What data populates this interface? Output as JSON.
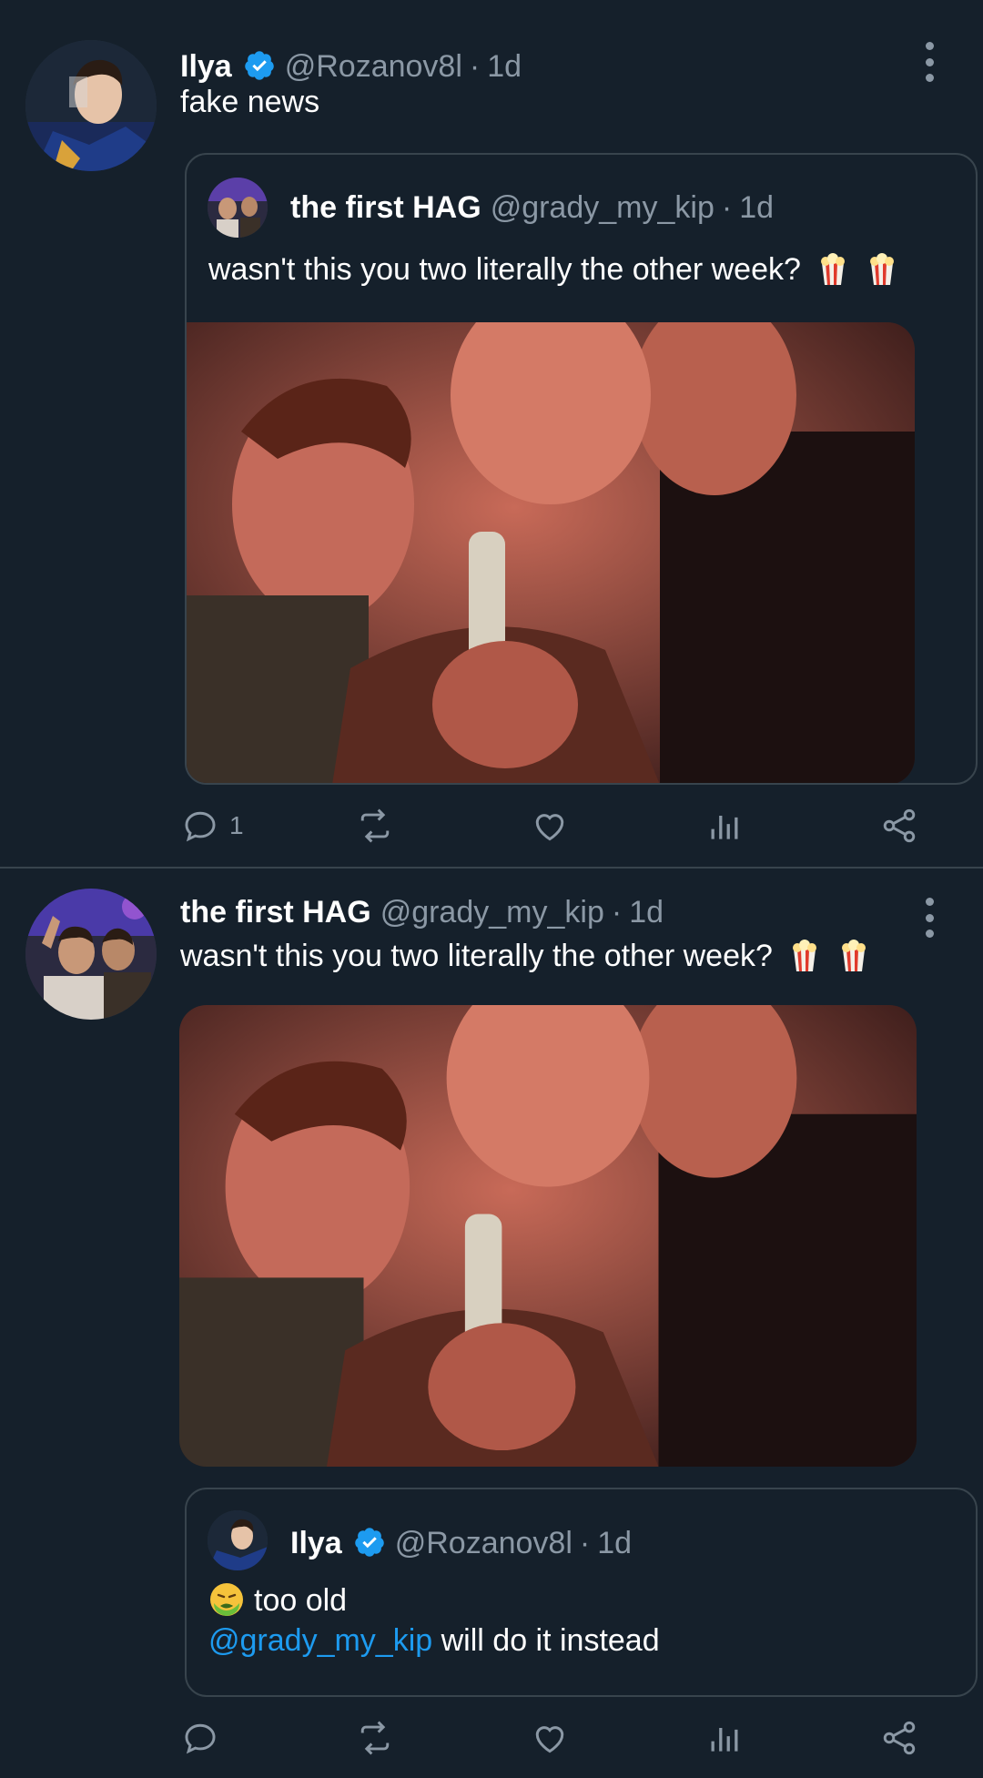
{
  "tweet1": {
    "author_name": "Ilya",
    "handle": "@Rozanov8l",
    "separator": "·",
    "time": "1d",
    "text": "fake news",
    "quote": {
      "author_name": "the first HAG",
      "handle": "@grady_my_kip",
      "separator": "·",
      "time": "1d",
      "text": "wasn't this you two literally the other week?"
    },
    "reply_count": "1"
  },
  "tweet2": {
    "author_name": "the first HAG",
    "handle": "@grady_my_kip",
    "separator": "·",
    "time": "1d",
    "text": "wasn't this you two literally the other week?",
    "quote": {
      "author_name": "Ilya",
      "handle": "@Rozanov8l",
      "separator": "·",
      "time": "1d",
      "line1": "too old",
      "mention": "@grady_my_kip",
      "line2_rest": " will do it instead"
    }
  },
  "icons": [
    "reply-icon",
    "retweet-icon",
    "like-icon",
    "analytics-icon",
    "share-icon",
    "verified-icon",
    "more-icon",
    "popcorn-emoji",
    "nauseated-face-emoji"
  ],
  "colors": {
    "background": "#15202b",
    "secondary_text": "#8b98a5",
    "border": "#38444d",
    "accent": "#1d9bf0"
  }
}
